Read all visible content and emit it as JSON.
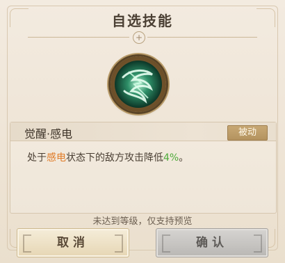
{
  "dialog": {
    "title": "自选技能",
    "ornament_symbol": "+"
  },
  "skill": {
    "icon": "green-swirl-skill-icon",
    "name": "觉醒·感电",
    "tag": "被动",
    "description": {
      "part1": "处于",
      "highlight1": "感电",
      "part2": "状态下的敌方攻击降低",
      "highlight2": "4%",
      "part3": "。"
    }
  },
  "notice": "未达到等级，仅支持预览",
  "buttons": {
    "cancel": "取消",
    "confirm": "确认"
  },
  "colors": {
    "highlight_orange": "#e07c28",
    "highlight_green": "#4eaa3a",
    "tag_gold": "#b4935f",
    "confirm_disabled_gray": "#b9b7b4"
  }
}
